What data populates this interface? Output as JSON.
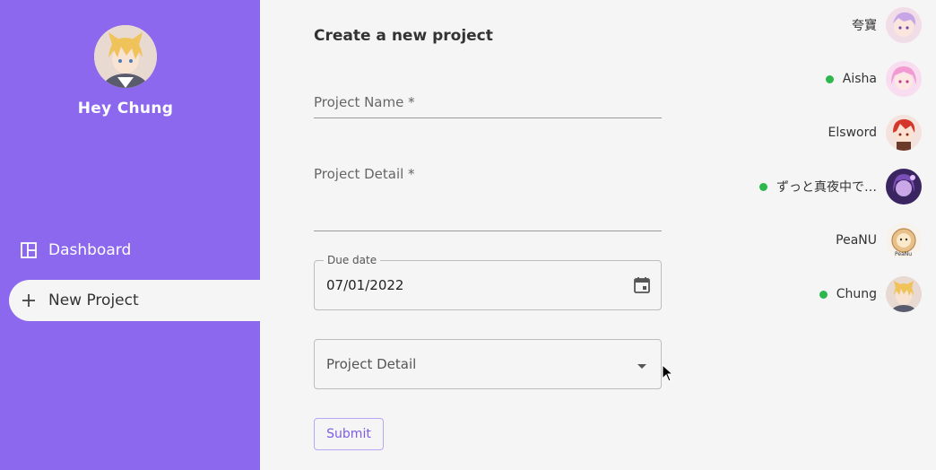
{
  "sidebar": {
    "user_name": "Hey Chung",
    "nav": [
      {
        "label": "Dashboard",
        "icon": "dashboard-icon"
      },
      {
        "label": "New Project",
        "icon": "plus-icon"
      }
    ],
    "background_color": "#8b68ee"
  },
  "form": {
    "title": "Create a new project",
    "project_name_label": "Project Name *",
    "project_detail_label": "Project Detail *",
    "due_date_legend": "Due date",
    "due_date_value": "07/01/2022",
    "select_placeholder": "Project Detail",
    "submit_label": "Submit"
  },
  "friends": [
    {
      "name": "夸寶",
      "online": false
    },
    {
      "name": "Aisha",
      "online": true
    },
    {
      "name": "Elsword",
      "online": false
    },
    {
      "name": "ずっと真夜中で…",
      "online": true
    },
    {
      "name": "PeaNU",
      "online": false
    },
    {
      "name": "Chung",
      "online": true
    }
  ],
  "colors": {
    "accent": "#8b68ee",
    "online": "#2db84d"
  }
}
